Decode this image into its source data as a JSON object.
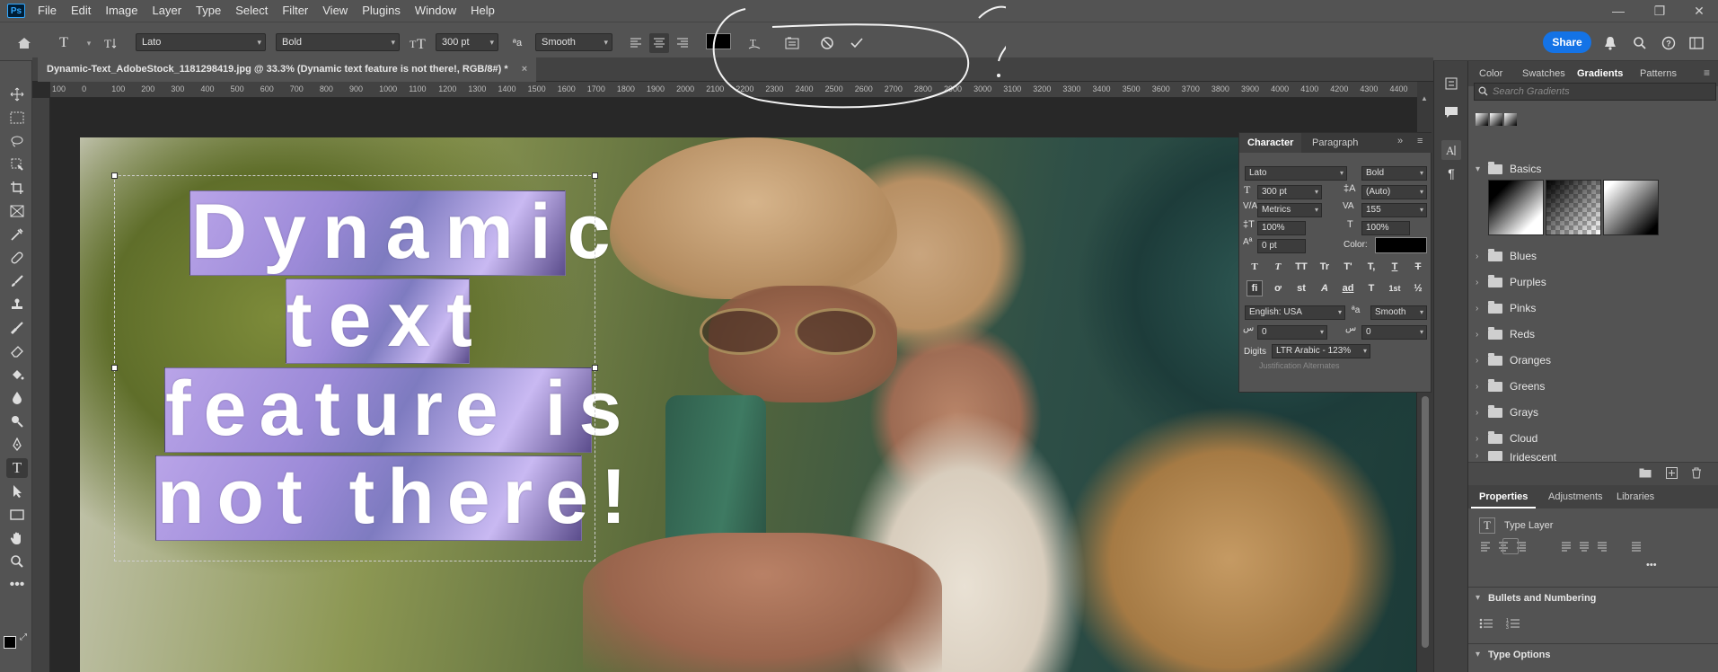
{
  "app": {
    "logo": "Ps"
  },
  "menu": [
    "File",
    "Edit",
    "Image",
    "Layer",
    "Type",
    "Select",
    "Filter",
    "View",
    "Plugins",
    "Window",
    "Help"
  ],
  "window_controls": {
    "minimize": "—",
    "restore": "❐",
    "close": "✕"
  },
  "options": {
    "font_family": "Lato",
    "font_style": "Bold",
    "font_size": "300 pt",
    "antialias": "Smooth",
    "aa_glyph": "ªa",
    "share_label": "Share"
  },
  "document": {
    "tab_title": "Dynamic-Text_AdobeStock_1181298419.jpg @ 33.3% (Dynamic text feature is not there!, RGB/8#) *",
    "close_glyph": "×"
  },
  "ruler_ticks": [
    "100",
    "0",
    "100",
    "200",
    "300",
    "400",
    "500",
    "600",
    "700",
    "800",
    "900",
    "1000",
    "1100",
    "1200",
    "1300",
    "1400",
    "1500",
    "1600",
    "1700",
    "1800",
    "1900",
    "2000",
    "2100",
    "2200",
    "2300",
    "2400",
    "2500",
    "2600",
    "2700",
    "2800",
    "2900",
    "3000",
    "3100",
    "3200",
    "3300",
    "3400",
    "3500",
    "3600",
    "3700",
    "3800",
    "3900",
    "4000",
    "4100",
    "4200",
    "4300",
    "4400"
  ],
  "canvas_text": {
    "line1": "Dynamic",
    "line2": "text",
    "line3": "feature is",
    "line4": "not there!"
  },
  "annotation": {
    "question_mark": "?"
  },
  "character_panel": {
    "tabs": [
      "Character",
      "Paragraph"
    ],
    "font_family": "Lato",
    "font_style": "Bold",
    "size": "300 pt",
    "leading": "(Auto)",
    "kerning": "Metrics",
    "tracking": "155",
    "vscale": "100%",
    "hscale": "100%",
    "baseline": "0 pt",
    "color_label": "Color:",
    "language": "English: USA",
    "antialias": "Smooth",
    "arabic1": "0",
    "arabic2": "0",
    "digits_label": "Digits",
    "digits_value": "LTR Arabic - 123%",
    "justification": "Justification Alternates",
    "style_buttons": [
      "T",
      "T",
      "TT",
      "Tr",
      "T'",
      "T,",
      "T",
      "T"
    ],
    "opentype_buttons": [
      "fi",
      "ơ",
      "st",
      "A",
      "ad",
      "T",
      "1st",
      "½"
    ]
  },
  "right_panel": {
    "tabs": [
      "Color",
      "Swatches",
      "Gradients",
      "Patterns"
    ],
    "search_placeholder": "Search Gradients",
    "folders": [
      "Basics",
      "Blues",
      "Purples",
      "Pinks",
      "Reds",
      "Oranges",
      "Greens",
      "Grays",
      "Cloud",
      "Iridescent"
    ],
    "properties_tabs": [
      "Properties",
      "Adjustments",
      "Libraries"
    ],
    "layer_type": "Type Layer",
    "more": "•••",
    "bullets_title": "Bullets and Numbering",
    "type_options_title": "Type Options"
  },
  "colors": {
    "accent": "#1473e6",
    "panel": "#535353",
    "dark": "#424242"
  }
}
